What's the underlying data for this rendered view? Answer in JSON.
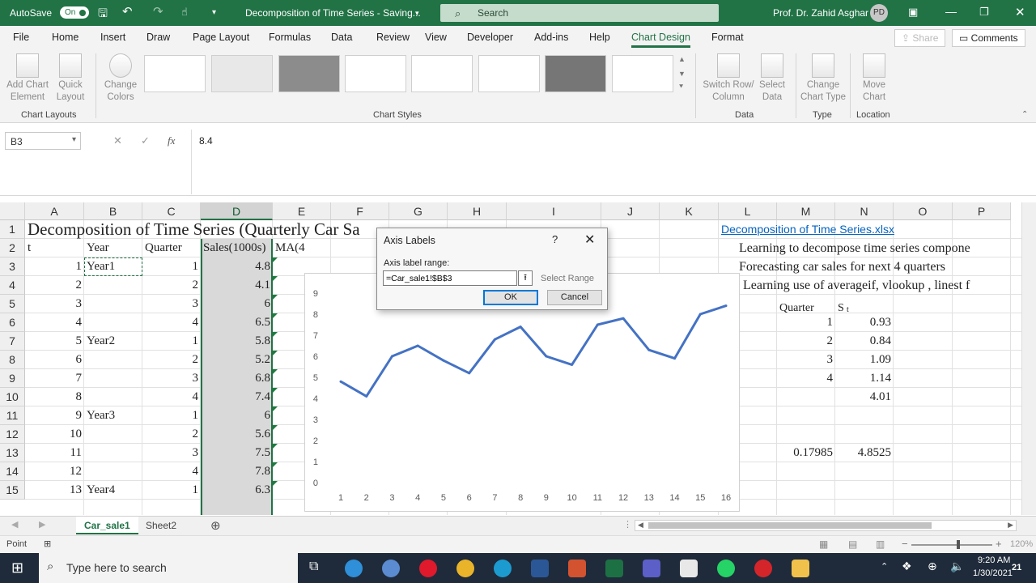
{
  "window": {
    "autosave_label": "AutoSave",
    "autosave_state": "On",
    "doc_title": "Decomposition of Time Series  -  Saving...",
    "search_placeholder": "Search",
    "user_name": "Prof. Dr. Zahid Asghar",
    "user_initials": "PD"
  },
  "ribbon_tabs": [
    "File",
    "Home",
    "Insert",
    "Draw",
    "Page Layout",
    "Formulas",
    "Data",
    "Review",
    "View",
    "Developer",
    "Add-ins",
    "Help",
    "Chart Design",
    "Format"
  ],
  "active_tab": "Chart Design",
  "share_label": "Share",
  "comments_label": "Comments",
  "ribbon": {
    "add_chart_element": "Add Chart Element",
    "quick_layout": "Quick Layout",
    "change_colors": "Change Colors",
    "switch_row_column": "Switch Row/ Column",
    "select_data": "Select Data",
    "change_chart_type": "Change Chart Type",
    "move_chart": "Move Chart",
    "groups": {
      "chart_layouts": "Chart Layouts",
      "chart_styles": "Chart Styles",
      "data": "Data",
      "type": "Type",
      "location": "Location"
    }
  },
  "formula_bar": {
    "name_box": "B3",
    "value": "8.4",
    "fx": "fx"
  },
  "columns": [
    "A",
    "B",
    "C",
    "D",
    "E",
    "F",
    "G",
    "H",
    "I",
    "J",
    "K",
    "L",
    "M",
    "N",
    "O",
    "P"
  ],
  "rows": [
    "1",
    "2",
    "3",
    "4",
    "5",
    "6",
    "7",
    "8",
    "9",
    "10",
    "11",
    "12",
    "13",
    "14",
    "15"
  ],
  "sheet": {
    "title": "Decomposition of Time Series (Quarterly Car Sa",
    "headers": {
      "t": "t",
      "year": "Year",
      "quarter": "Quarter",
      "sales": "Sales(1000s)",
      "ma": "MA(4"
    },
    "t": [
      "1",
      "2",
      "3",
      "4",
      "5",
      "6",
      "7",
      "8",
      "9",
      "10",
      "11",
      "12",
      "13"
    ],
    "years": {
      "r3": "Year1",
      "r7": "Year2",
      "r11": "Year3",
      "r15": "Year4"
    },
    "quarter": [
      "1",
      "2",
      "3",
      "4",
      "1",
      "2",
      "3",
      "4",
      "1",
      "2",
      "3",
      "4",
      "1"
    ],
    "sales": [
      "4.8",
      "4.1",
      "6",
      "6.5",
      "5.8",
      "5.2",
      "6.8",
      "7.4",
      "6",
      "5.6",
      "7.5",
      "7.8",
      "6.3"
    ],
    "link": "Decomposition of Time Series.xlsx",
    "notes": [
      "Learning to decompose time series compone",
      "Forecasting car sales for next 4 quarters",
      "Learning use of  averageif, vlookup , linest f"
    ],
    "season_header_q": "Quarter",
    "season_header_s": "S",
    "season_header_s_sub": "t",
    "season_q": [
      "1",
      "2",
      "3",
      "4"
    ],
    "season_s": [
      "0.93",
      "0.84",
      "1.09",
      "1.14",
      "4.01"
    ],
    "m13": "0.17985",
    "n13": "4.8525"
  },
  "chart_data": {
    "type": "line",
    "x": [
      1,
      2,
      3,
      4,
      5,
      6,
      7,
      8,
      9,
      10,
      11,
      12,
      13,
      14,
      15,
      16
    ],
    "series": [
      {
        "values": [
          4.8,
          4.1,
          6,
          6.5,
          5.8,
          5.2,
          6.8,
          7.4,
          6,
          5.6,
          7.5,
          7.8,
          6.3,
          5.9,
          8,
          8.4
        ]
      }
    ],
    "ylim": [
      0,
      9
    ],
    "yticks": [
      "0",
      "1",
      "2",
      "3",
      "4",
      "5",
      "6",
      "7",
      "8",
      "9"
    ],
    "xticks": [
      "1",
      "2",
      "3",
      "4",
      "5",
      "6",
      "7",
      "8",
      "9",
      "10",
      "11",
      "12",
      "13",
      "14",
      "15",
      "16"
    ],
    "grid": false,
    "color": "#4472c4"
  },
  "dialog": {
    "title": "Axis Labels",
    "help": "?",
    "close": "✕",
    "label": "Axis label range:",
    "value": "=Car_sale1!$B$3",
    "select_range": "Select Range",
    "ok": "OK",
    "cancel": "Cancel"
  },
  "sheet_tabs": [
    "Car_sale1",
    "Sheet2"
  ],
  "status": {
    "mode": "Point",
    "zoom": "120%"
  },
  "taskbar": {
    "search_placeholder": "Type here to search",
    "time": "9:20 AM",
    "date": "1/30/2021",
    "notifications": "21"
  }
}
